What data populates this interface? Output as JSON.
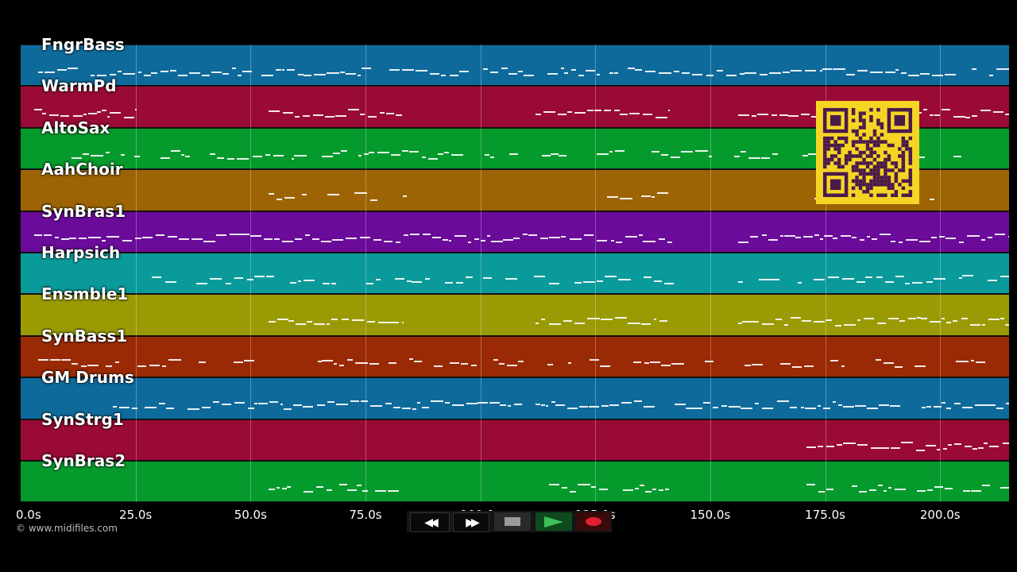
{
  "tracks": [
    {
      "name": "FngrBass",
      "color": "#0f6a9c"
    },
    {
      "name": "WarmPd",
      "color": "#9a0a36"
    },
    {
      "name": "AltoSax",
      "color": "#059a2c"
    },
    {
      "name": "AahChoir",
      "color": "#9c6405"
    },
    {
      "name": "SynBras1",
      "color": "#6a0b9a"
    },
    {
      "name": "Harpsich",
      "color": "#0a9a9a"
    },
    {
      "name": "Ensmble1",
      "color": "#9a9a05"
    },
    {
      "name": "SynBass1",
      "color": "#9a2a05"
    },
    {
      "name": "GM Drums",
      "color": "#0f6a9c"
    },
    {
      "name": "SynStrg1",
      "color": "#9a0a36"
    },
    {
      "name": "SynBras2",
      "color": "#059a2c"
    }
  ],
  "timeline": {
    "max_seconds": 215,
    "ticks": [
      "0.0s",
      "25.0s",
      "50.0s",
      "75.0s",
      "100.0s",
      "125.0s",
      "150.0s",
      "175.0s",
      "200.0s"
    ],
    "tick_values": [
      0,
      25,
      50,
      75,
      100,
      125,
      150,
      175,
      200
    ]
  },
  "copyright": "© www.midifiles.com",
  "transport": {
    "rewind_icon": "rewind-icon",
    "fast_forward_icon": "fast-forward-icon",
    "stop_icon": "stop-icon",
    "play_icon": "play-icon",
    "record_icon": "record-icon"
  },
  "qr_code": {
    "accent": "#f5d524",
    "dark": "#4a1a4a"
  }
}
